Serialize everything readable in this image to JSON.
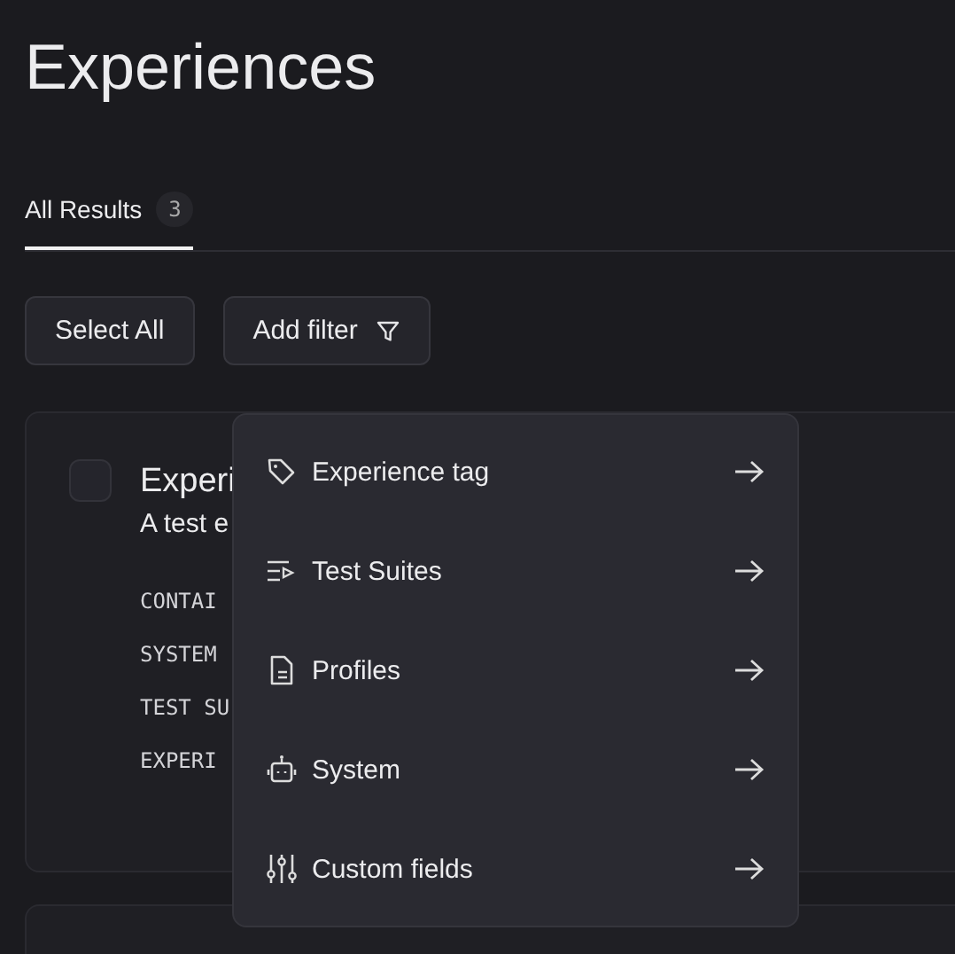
{
  "title": "Experiences",
  "tabs": [
    {
      "label": "All Results",
      "count": "3",
      "selected": true
    }
  ],
  "buttons": [
    {
      "kind": "plain",
      "label": "Select All"
    },
    {
      "kind": "filter",
      "label": "Add filter"
    }
  ],
  "card": {
    "checked": false,
    "title": "Experi",
    "description": "A test e",
    "fields": [
      "CONTAI",
      "SYSTEM",
      "TEST SU",
      "EXPERI"
    ]
  },
  "menu": {
    "items": [
      {
        "kind": "tag",
        "label": "Experience tag"
      },
      {
        "kind": "suites",
        "label": "Test Suites"
      },
      {
        "kind": "profile",
        "label": "Profiles"
      },
      {
        "kind": "robot",
        "label": "System"
      },
      {
        "kind": "sliders",
        "label": "Custom fields"
      }
    ]
  }
}
